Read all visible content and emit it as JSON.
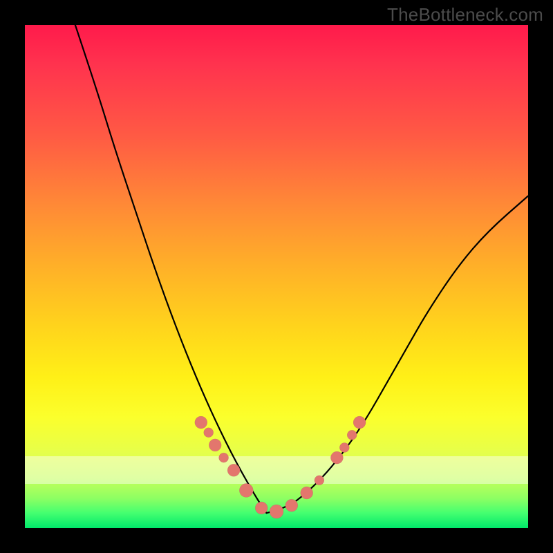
{
  "watermark": "TheBottleneck.com",
  "colors": {
    "background": "#000000",
    "watermark_text": "#4b4b4b",
    "curve": "#000000",
    "dot": "#e3766d",
    "gradient_top": "#ff1a4b",
    "gradient_bottom": "#00e86a"
  },
  "chart_data": {
    "type": "line",
    "title": "",
    "xlabel": "",
    "ylabel": "",
    "xlim": [
      0,
      100
    ],
    "ylim": [
      0,
      100
    ],
    "description": "V-shaped bottleneck curve; value is the curve height as a percentage of the plot height (0 = bottom, 100 = top). Minimum near x≈48 at y≈3. Background is a vertical gradient from red (top) through yellow to green (bottom).",
    "series": [
      {
        "name": "left-branch",
        "x": [
          10,
          14,
          18,
          22,
          26,
          30,
          34,
          38,
          42,
          46,
          48
        ],
        "y": [
          100,
          88,
          75,
          63,
          51,
          40,
          30,
          21,
          13,
          6,
          3
        ]
      },
      {
        "name": "right-branch",
        "x": [
          48,
          52,
          56,
          60,
          64,
          68,
          72,
          76,
          80,
          86,
          92,
          100
        ],
        "y": [
          3,
          4,
          7,
          11,
          16,
          22,
          29,
          36,
          43,
          52,
          59,
          66
        ]
      }
    ],
    "markers": {
      "name": "highlighted-points",
      "x": [
        35.0,
        36.5,
        37.8,
        39.5,
        41.5,
        44.0,
        47.0,
        50.0,
        53.0,
        56.0,
        58.5,
        62.0,
        63.5,
        65.0,
        66.5
      ],
      "y": [
        21.0,
        19.0,
        16.5,
        14.0,
        11.5,
        7.5,
        4.0,
        3.3,
        4.5,
        7.0,
        9.5,
        14.0,
        16.0,
        18.5,
        21.0
      ],
      "r": [
        9,
        7,
        9,
        7,
        9,
        10,
        9,
        10,
        9,
        9,
        7,
        9,
        7,
        7,
        9
      ]
    }
  }
}
